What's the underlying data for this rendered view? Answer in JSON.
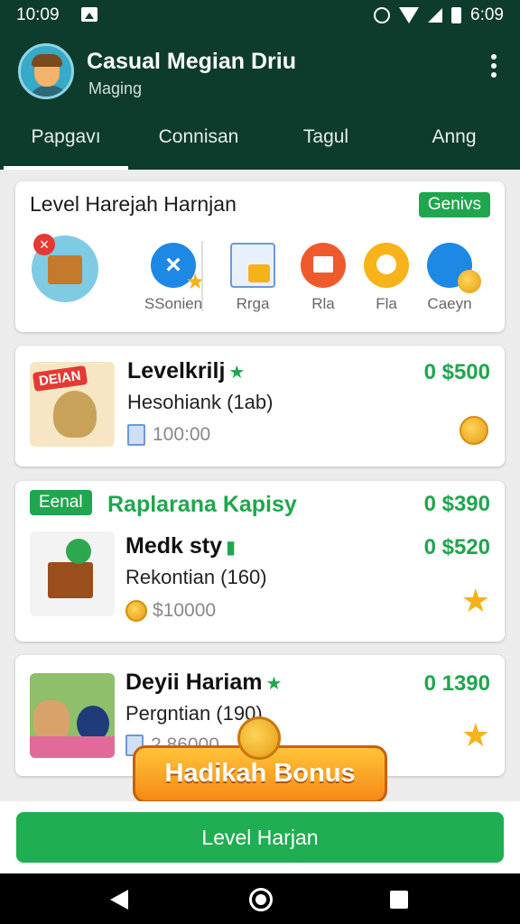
{
  "statusbar": {
    "time_left": "10:09",
    "time_right": "6:09"
  },
  "header": {
    "title": "Casual Megian Driu",
    "subtitle": "Maging"
  },
  "tabs": [
    {
      "label": "Papgavı",
      "active": true
    },
    {
      "label": "Connisan",
      "active": false
    },
    {
      "label": "Tagul",
      "active": false
    },
    {
      "label": "Anng",
      "active": false
    }
  ],
  "categories_card": {
    "title": "Level Harejah Harnjan",
    "badge": "Genivs",
    "items": [
      {
        "label": "",
        "icon": "gift-box-icon"
      },
      {
        "label": "SSonien",
        "icon": "close-circle-icon"
      },
      {
        "label": "Rrga",
        "icon": "window-icon"
      },
      {
        "label": "Rla",
        "icon": "grid-icon"
      },
      {
        "label": "Fla",
        "icon": "chat-bubble-icon"
      },
      {
        "label": "Caeyn",
        "icon": "megaphone-icon"
      }
    ]
  },
  "offers": [
    {
      "thumb_label": "DEIAN",
      "title": "Levelkrilj",
      "subtitle": "Hesohiank (1ab)",
      "meta": "100:00",
      "price": "0 $500",
      "thumb_icon": "coin-bag-icon",
      "right_icon": "coin-icon"
    },
    {
      "tag": "Eenal",
      "header": "Raplarana Kapisy",
      "header_price": "0 $390",
      "title": "Medk sty",
      "subtitle": "Rekontian (160)",
      "meta": "$10000",
      "price": "0 $520",
      "thumb_icon": "box-icon",
      "right_icon": "star-icon"
    },
    {
      "title": "Deyii Hariam",
      "subtitle": "Pergntian (190)",
      "meta": "2.86000",
      "price": "0 1390",
      "thumb_icon": "pets-photo-icon",
      "right_icon": "star-icon"
    }
  ],
  "bonus_label": "Hadikah Bonus",
  "main_button": "Level Harjan",
  "colors": {
    "header": "#0d3b2c",
    "accent": "#1fa64e",
    "bonus": "#f59a1c"
  }
}
